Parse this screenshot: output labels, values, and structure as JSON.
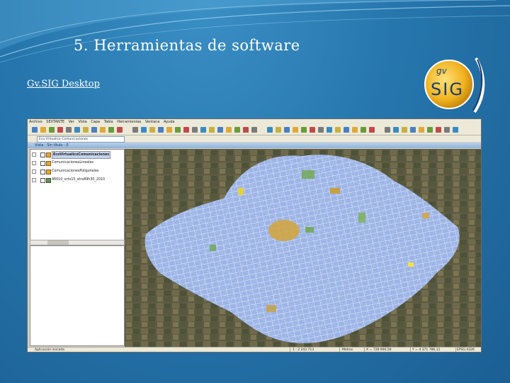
{
  "slide": {
    "title": "5. Herramientas de software",
    "subtitle": "Gv.SIG  Desktop"
  },
  "logo": {
    "icon": "gvsig-logo-icon",
    "colors": {
      "ring": "#e5a31a",
      "text": "#1c3c6c"
    }
  },
  "app": {
    "menu": [
      "Archivo",
      "SEXTANTE",
      "Ver",
      "Vista",
      "Capa",
      "Tabla",
      "Herramientas",
      "Ventana",
      "Ayuda"
    ],
    "combo_value": "Eco Virtualico Comunicaciones",
    "view_title": "Vista : Sin título - 0",
    "layers": [
      {
        "name": "EcoVirtualicoComunicaciones",
        "selected": true
      },
      {
        "name": "ComunicacionesLineales",
        "selected": false
      },
      {
        "name": "ComunicacionesPoligonales",
        "selected": false
      },
      {
        "name": "46010_orto15_etrs89h30_2010",
        "selected": false
      }
    ],
    "status": {
      "message": "Aplicación iniciada",
      "scale": "1 : 2 243 713",
      "units": "Metros",
      "x": "X = 728 900,58",
      "y": "Y = 4 371 786,11",
      "crs": "EPSG:4326"
    },
    "colors": {
      "chrome": "#ece9d8",
      "network": "#9cb4e6",
      "accent": "#2676ad"
    }
  }
}
